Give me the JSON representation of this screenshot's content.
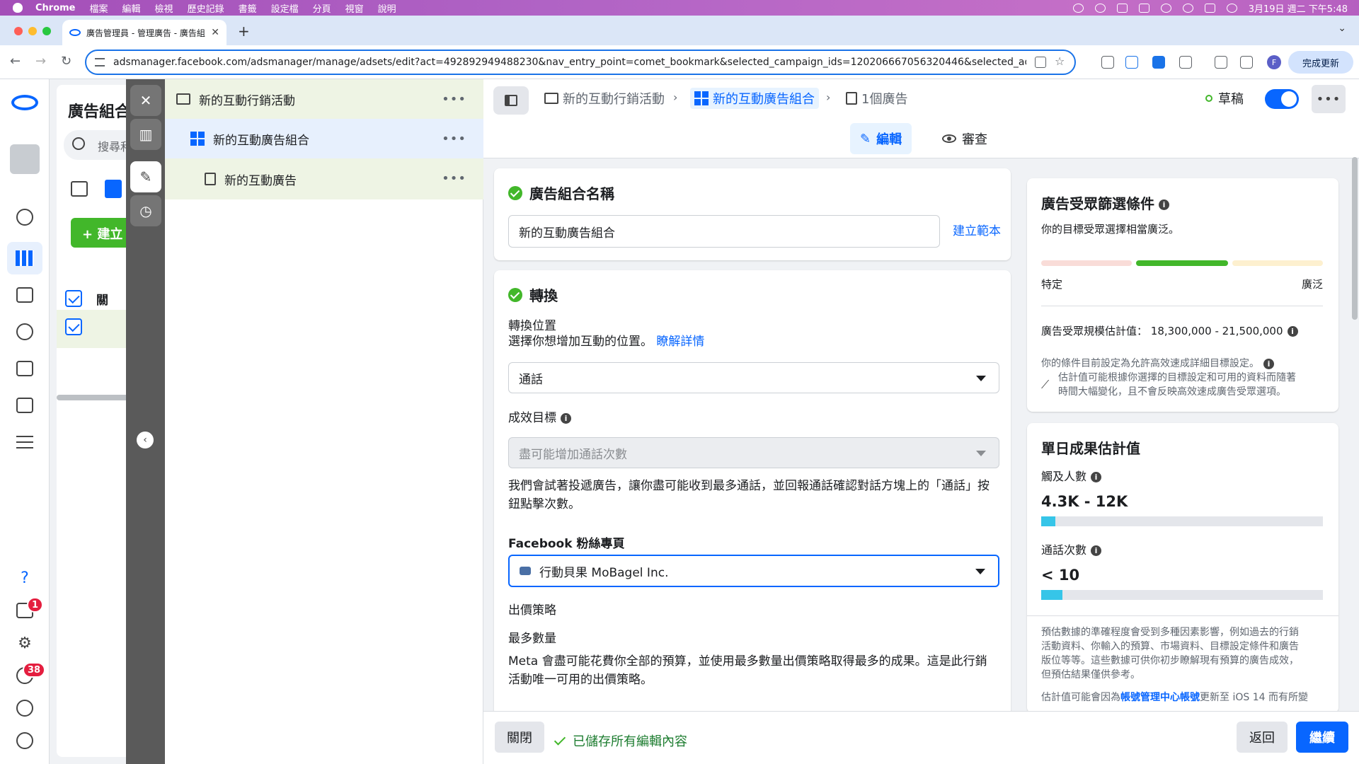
{
  "menubar": {
    "app": "Chrome",
    "items": [
      "檔案",
      "編輯",
      "檢視",
      "歷史記錄",
      "書籤",
      "設定檔",
      "分頁",
      "視窗",
      "說明"
    ],
    "clock": "3月19日 週二 下午5:48"
  },
  "browser": {
    "tab_title": "廣告管理員 - 管理廣告 - 廣告組",
    "url": "adsmanager.facebook.com/adsmanager/manage/adsets/edit?act=492892949488230&nav_entry_point=comet_bookmark&selected_campaign_ids=120206667056320446&selected_adset_ids=1...",
    "update_label": "完成更新",
    "profile_initial": "F"
  },
  "leftnav": {
    "badges": {
      "notifications_small": "1",
      "notifications": "38"
    }
  },
  "bgpanel": {
    "title": "廣告組合",
    "search_placeholder": "搜尋和",
    "create_label": "建立",
    "col_header": "關"
  },
  "tree": {
    "campaign": "新的互動行銷活動",
    "adset": "新的互動廣告組合",
    "ad": "新的互動廣告",
    "more": "•••"
  },
  "topbar": {
    "breadcrumb": [
      "新的互動行銷活動",
      "新的互動廣告組合",
      "1個廣告"
    ],
    "status": "草稿",
    "more": "•••"
  },
  "modes": {
    "edit": "編輯",
    "review": "審查"
  },
  "adset_name_card": {
    "title": "廣告組合名稱",
    "value": "新的互動廣告組合",
    "template_link": "建立範本"
  },
  "conversion_card": {
    "title": "轉換",
    "location_label": "轉換位置",
    "location_help": "選擇你想增加互動的位置。",
    "learn_more": "瞭解詳情",
    "location_value": "通話",
    "goal_label": "成效目標",
    "goal_value": "盡可能增加通話次數",
    "goal_desc_1": "我們會試著投遞廣告，讓你盡可能收到最多通話，並回報通話確認對話方塊上的「通話」按",
    "goal_desc_2": "鈕點擊次數。",
    "page_label": "Facebook 粉絲專頁",
    "page_value": "行動貝果 MoBagel Inc.",
    "bid_label": "出價策略",
    "bid_value": "最多數量",
    "bid_desc_1": "Meta 會盡可能花費你全部的預算，並使用最多數量出價策略取得最多的成果。這是此行銷",
    "bid_desc_2": "活動唯一可用的出價策略。"
  },
  "audience_card": {
    "title": "廣告受眾篩選條件",
    "breadth_text": "你的目標受眾選擇相當廣泛。",
    "specific": "特定",
    "broad": "廣泛",
    "size_label": "廣告受眾規模估計值：",
    "size_value": "18,300,000 - 21,500,000",
    "note_1": "你的條件目前設定為允許高效速成詳細目標設定。",
    "note_2": "估計值可能根據你選擇的目標設定和可用的資料而隨著",
    "note_3": "時間大幅變化，且不會反映高效速成廣告受眾選項。"
  },
  "results_card": {
    "title": "單日成果估計值",
    "reach_label": "觸及人數",
    "reach_value": "4.3K - 12K",
    "reach_fill": 0.05,
    "calls_label": "通話次數",
    "calls_value": "< 10",
    "calls_fill": 0.075,
    "disclaimer_1": "預估數據的準確程度會受到多種因素影響，例如過去的行銷",
    "disclaimer_2": "活動資料、你輸入的預算、市場資料、目標設定條件和廣告",
    "disclaimer_3": "版位等等。這些數據可供你初步瞭解現有預算的廣告成效，",
    "disclaimer_4": "但預估結果僅供參考。",
    "disclaimer_5a": "估計值可能會因為",
    "disclaimer_5link": "帳號管理中心帳號",
    "disclaimer_5b": "更新至 iOS 14 而有所變"
  },
  "bottombar": {
    "close": "關閉",
    "saved": "已儲存所有編輯內容",
    "back": "返回",
    "continue": "繼續"
  },
  "colors": {
    "accent": "#0866ff",
    "success": "#42b72a",
    "meter_low": "#f9dcd8",
    "meter_high": "#fdf0cf"
  }
}
